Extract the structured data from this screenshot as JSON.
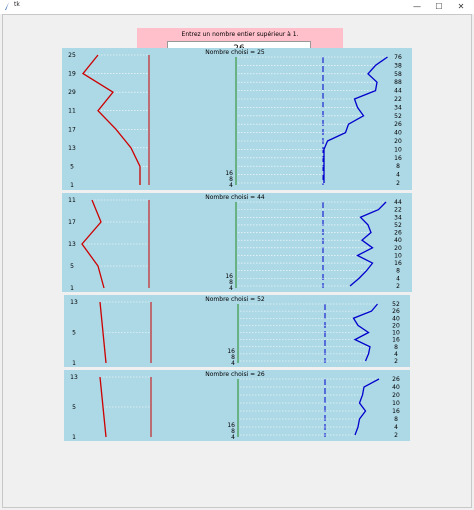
{
  "window": {
    "title": "tk",
    "minimize": "—",
    "maximize": "☐",
    "close": "✕"
  },
  "input_panel": {
    "prompt": "Entrez un nombre entier supérieur à 1.",
    "value": "26"
  },
  "colors": {
    "background": "#add8e6",
    "left_line": "#cc0000",
    "middle_line": "#228b22",
    "right_line": "#0000cc",
    "input_panel": "#ffc0cb"
  },
  "chart_data": [
    {
      "type": "line",
      "title": "Nombre choisi = 25",
      "left_labels": [
        "25",
        "19",
        "29",
        "11",
        "17",
        "13",
        "5",
        "1"
      ],
      "right_labels": [
        "76",
        "38",
        "58",
        "88",
        "44",
        "22",
        "34",
        "52",
        "26",
        "40",
        "20",
        "10",
        "16",
        "8",
        "4",
        "2"
      ]
    },
    {
      "type": "line",
      "title": "Nombre choisi = 44",
      "left_labels": [
        "11",
        "17",
        "13",
        "5",
        "1"
      ],
      "right_labels": [
        "44",
        "22",
        "34",
        "52",
        "26",
        "40",
        "20",
        "10",
        "16",
        "8",
        "4",
        "2"
      ]
    },
    {
      "type": "line",
      "title": "Nombre choisi = 52",
      "left_labels": [
        "13",
        "5",
        "1"
      ],
      "right_labels": [
        "52",
        "26",
        "40",
        "20",
        "10",
        "16",
        "8",
        "4",
        "2"
      ]
    },
    {
      "type": "line",
      "title": "Nombre choisi = 26",
      "left_labels": [
        "13",
        "5",
        "1"
      ],
      "right_labels": [
        "26",
        "40",
        "20",
        "10",
        "16",
        "8",
        "4",
        "2"
      ]
    }
  ]
}
